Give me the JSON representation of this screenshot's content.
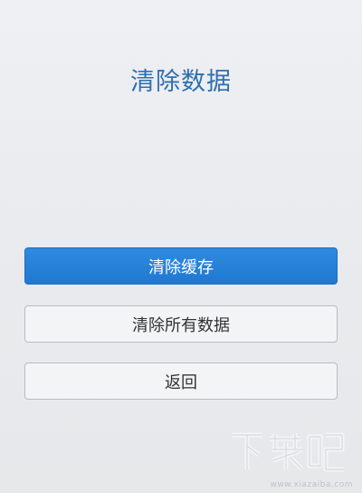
{
  "page": {
    "title": "清除数据"
  },
  "actions": {
    "clear_cache_label": "清除缓存",
    "clear_all_data_label": "清除所有数据",
    "back_label": "返回"
  },
  "watermark": {
    "logo_text": "下载吧",
    "url": "www.xiazaiba.com"
  },
  "colors": {
    "title": "#2f6fb0",
    "primary_button": "#1f79d2",
    "background": "#e9ebee"
  }
}
